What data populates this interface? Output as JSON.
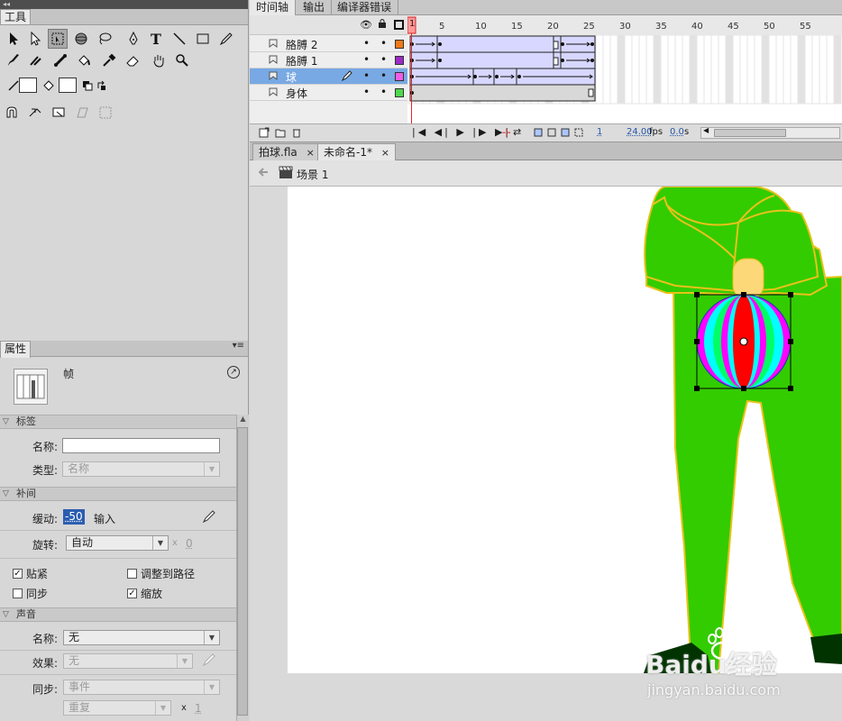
{
  "tools_panel": {
    "title": "工具",
    "tools_row1": [
      "selection-arrow-icon",
      "subselection-arrow-icon",
      "free-transform-icon",
      "3d-rotation-icon",
      "lasso-icon",
      "pen-icon",
      "text-icon",
      "line-icon",
      "rectangle-icon",
      "pencil-icon"
    ],
    "tools_row2": [
      "brush-icon",
      "deco-icon",
      "bone-icon",
      "paint-bucket-icon",
      "eyedropper-icon",
      "eraser-icon",
      "hand-icon",
      "zoom-icon"
    ],
    "stroke_color": "#ffffff",
    "fill_color": "#ffffff",
    "text_tool": "T"
  },
  "properties_panel": {
    "title": "属性",
    "frame_label": "帧",
    "sections": {
      "label": "标签",
      "tween": "补间",
      "sound": "声音"
    },
    "label_name": "名称:",
    "label_name_value": "",
    "label_type": "类型:",
    "label_type_value": "名称",
    "ease_label": "缓动:",
    "ease_value": "-50",
    "ease_input": "输入",
    "rotate_label": "旋转:",
    "rotate_value": "自动",
    "rotate_times_x": "x",
    "rotate_times": "0",
    "snap_label": "贴紧",
    "orient_label": "调整到路径",
    "sync_label": "同步",
    "scale_label": "缩放",
    "snap_checked": true,
    "orient_checked": false,
    "sync_checked": false,
    "scale_checked": true,
    "sound_name_label": "名称:",
    "sound_name_value": "无",
    "sound_effect_label": "效果:",
    "sound_effect_value": "无",
    "sound_sync_label": "同步:",
    "sound_sync_value": "事件",
    "sound_repeat_value": "重复",
    "sound_repeat_x": "x",
    "sound_repeat_count": "1"
  },
  "timeline": {
    "tabs": [
      "时间轴",
      "输出",
      "编译器错误"
    ],
    "frame_numbers": [
      "5",
      "10",
      "15",
      "20",
      "25",
      "30",
      "35",
      "40",
      "45",
      "50",
      "55"
    ],
    "playhead_frame": "1",
    "layers": [
      {
        "name": "胳膊 2",
        "color": "#f07a18",
        "selected": false
      },
      {
        "name": "胳膊 1",
        "color": "#9b2ac8",
        "selected": false
      },
      {
        "name": "球",
        "color": "#f25ce6",
        "selected": true
      },
      {
        "name": "身体",
        "color": "#4ed84e",
        "selected": false
      }
    ],
    "current_frame": "1",
    "fps": "24.00",
    "fps_unit": "fps",
    "time": "0.0",
    "time_unit": "s"
  },
  "documents": {
    "tabs": [
      {
        "name": "拍球.fla",
        "active": false
      },
      {
        "name": "未命名-1*",
        "active": true
      }
    ],
    "close_glyph": "×"
  },
  "edit_bar": {
    "scene": "场景 1"
  },
  "colors": {
    "body_green": "#33cc00",
    "outline_yellow": "#e8c21a",
    "hand_skin": "#fcd879",
    "shoe_dark": "#003300",
    "ball_red": "#ff0000",
    "ball_magenta": "#ff00ff",
    "ball_cyan": "#00ffff",
    "ball_green": "#00ff66"
  },
  "watermark": {
    "brand": "Baidu经验",
    "url": "jingyan.baidu.com"
  }
}
